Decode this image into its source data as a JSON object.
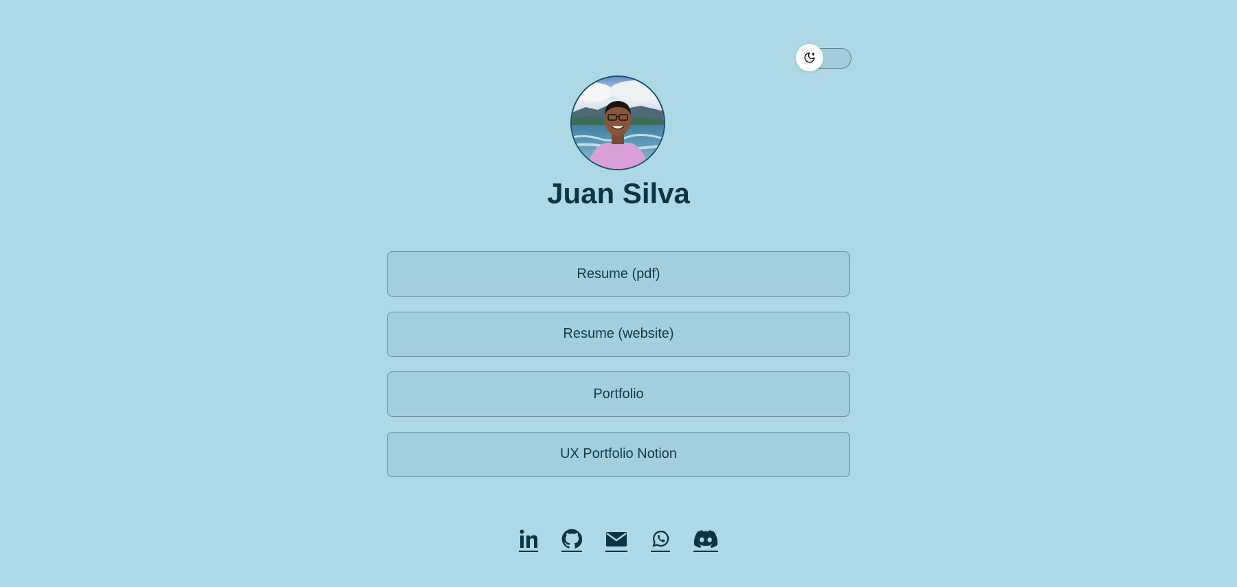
{
  "theme_toggle": {
    "icon": "moon-stars-icon",
    "state": "light"
  },
  "profile": {
    "name": "Juan Silva",
    "avatar": "profile-photo"
  },
  "links": [
    {
      "label": "Resume (pdf)"
    },
    {
      "label": "Resume (website)"
    },
    {
      "label": "Portfolio"
    },
    {
      "label": "UX Portfolio Notion"
    }
  ],
  "socials": [
    {
      "icon": "linkedin-icon"
    },
    {
      "icon": "github-icon"
    },
    {
      "icon": "email-icon"
    },
    {
      "icon": "whatsapp-icon"
    },
    {
      "icon": "discord-icon"
    }
  ],
  "colors": {
    "background": "#add8e6",
    "button_bg": "#a3cedd",
    "text": "#0b3547"
  }
}
